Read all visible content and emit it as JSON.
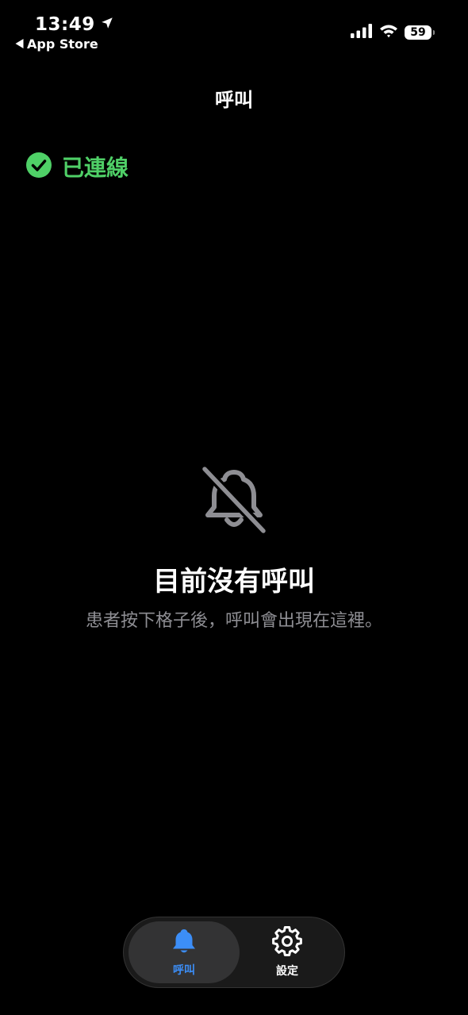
{
  "status_bar": {
    "time": "13:49",
    "back_label": "App Store",
    "battery": "59",
    "icons": [
      "location-arrow-icon",
      "signal-icon",
      "wifi-icon",
      "battery-icon"
    ]
  },
  "nav": {
    "title": "呼叫"
  },
  "connection": {
    "label": "已連線",
    "icon": "check-circle-icon",
    "color": "#4fd067"
  },
  "empty_state": {
    "icon": "bell-slash-icon",
    "title": "目前沒有呼叫",
    "subtitle": "患者按下格子後，呼叫會出現在這裡。"
  },
  "tabs": [
    {
      "label": "呼叫",
      "icon": "bell-icon",
      "selected": true
    },
    {
      "label": "設定",
      "icon": "gear-icon",
      "selected": false
    }
  ],
  "colors": {
    "accent": "#3c8ef7",
    "connected": "#4fd067",
    "secondary_text": "#8e8e93"
  }
}
